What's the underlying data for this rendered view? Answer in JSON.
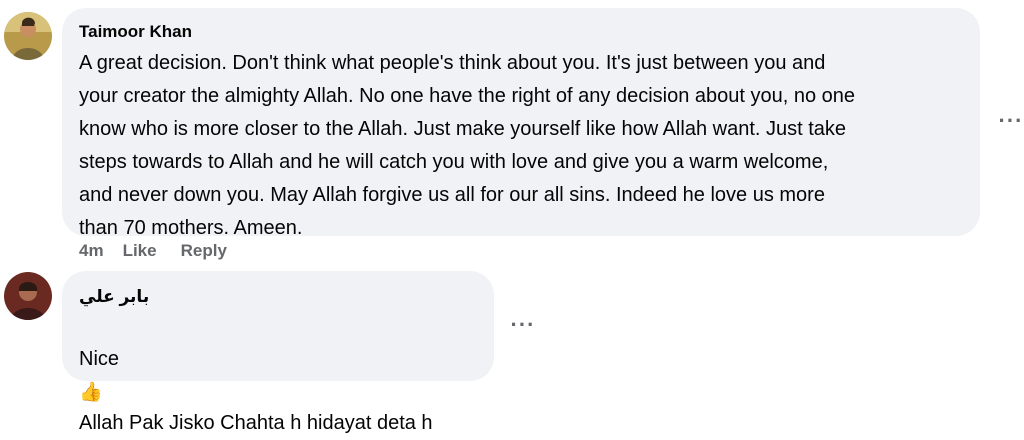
{
  "comments": [
    {
      "author": "Taimoor Khan",
      "text": "A great decision. Don't think what people's think about you. It's just between you and\nyour creator the almighty Allah. No one have the right of any decision about you, no one\nknow who is more closer to the Allah. Just make yourself like how Allah want. Just take\nsteps towards to Allah and he will catch you with love and give you a warm welcome,\nand never down you. May Allah forgive us all for our all sins. Indeed he love us more\nthan 70 mothers. Ameen.",
      "time": "4m",
      "like_label": "Like",
      "reply_label": "Reply",
      "more_label": "···"
    },
    {
      "author": "بابر علي",
      "text_line1": "Nice",
      "emoji": "👍",
      "text_line2": "Allah Pak Jisko Chahta h hidayat deta h",
      "more_label": "···"
    }
  ]
}
